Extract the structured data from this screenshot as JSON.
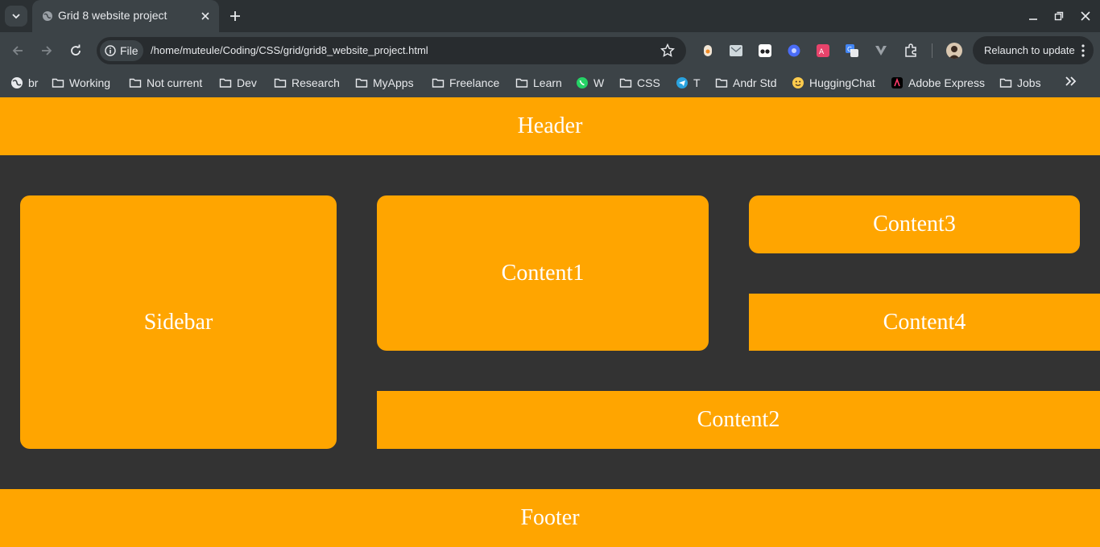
{
  "browser": {
    "tab_title": "Grid 8 website project",
    "site_chip_label": "File",
    "url": "/home/muteule/Coding/CSS/grid/grid8_website_project.html",
    "relaunch_label": "Relaunch to update"
  },
  "bookmarks": [
    {
      "label": "br",
      "icon": "globe-icon"
    },
    {
      "label": "Working",
      "icon": "folder-icon"
    },
    {
      "label": "Not current",
      "icon": "folder-icon"
    },
    {
      "label": "Dev",
      "icon": "folder-icon"
    },
    {
      "label": "Research",
      "icon": "folder-icon"
    },
    {
      "label": "MyApps",
      "icon": "folder-icon"
    },
    {
      "label": "Freelance",
      "icon": "folder-icon"
    },
    {
      "label": "Learn",
      "icon": "folder-icon"
    },
    {
      "label": "W",
      "icon": "whatsapp-icon"
    },
    {
      "label": "CSS",
      "icon": "folder-icon"
    },
    {
      "label": "T",
      "icon": "telegram-icon"
    },
    {
      "label": "Andr Std",
      "icon": "folder-icon"
    },
    {
      "label": "HuggingChat",
      "icon": "huggingface-icon"
    },
    {
      "label": "Adobe Express",
      "icon": "adobe-icon"
    },
    {
      "label": "Jobs",
      "icon": "folder-icon"
    }
  ],
  "page": {
    "header": "Header",
    "sidebar": "Sidebar",
    "content1": "Content1",
    "content2": "Content2",
    "content3": "Content3",
    "content4": "Content4",
    "footer": "Footer"
  },
  "colors": {
    "accent": "#ffa500",
    "background": "#333333",
    "text": "#ffffff"
  }
}
